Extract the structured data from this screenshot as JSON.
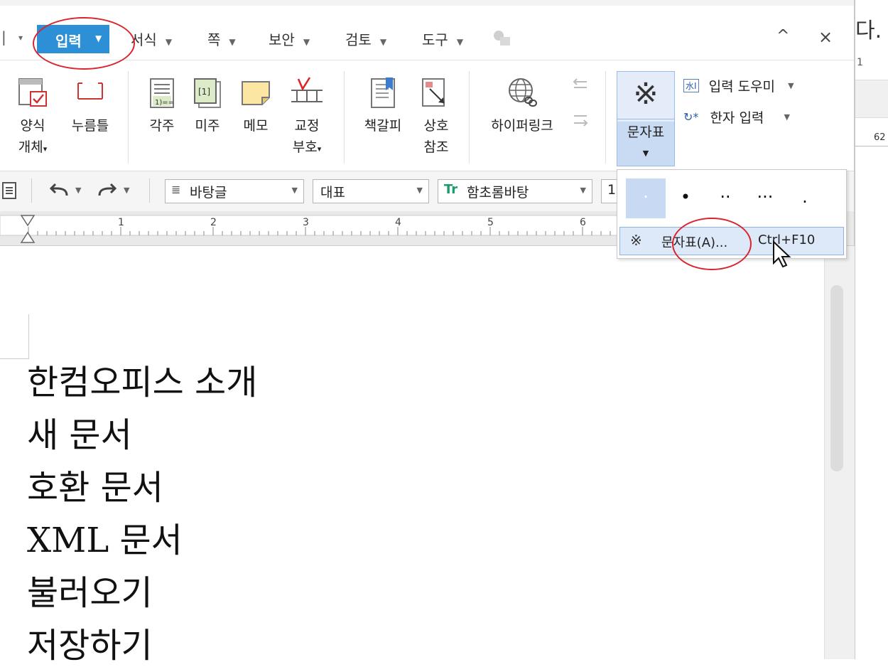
{
  "right_panel": {
    "top_char": "다.",
    "number_one": "1",
    "number": "62"
  },
  "menu": {
    "first_arrow": "▾",
    "items": [
      {
        "label": "입력",
        "active": true
      },
      {
        "label": "서식"
      },
      {
        "label": "쪽"
      },
      {
        "label": "보안"
      },
      {
        "label": "검토"
      },
      {
        "label": "도구"
      }
    ],
    "collapse": "^",
    "close": "×"
  },
  "ribbon": {
    "form_object": [
      "양식",
      "개체"
    ],
    "press_button": "누름틀",
    "footnote": "각주",
    "endnote": "미주",
    "memo": "메모",
    "proofread": [
      "교정",
      "부호"
    ],
    "bookmark": "책갈피",
    "cross_ref": [
      "상호",
      "참조"
    ],
    "hyperlink": "하이퍼링크",
    "char_map": "문자표",
    "input_helper": "입력 도우미",
    "hanja_input": "한자 입력"
  },
  "toolbar": {
    "style": "바탕글",
    "lang": "대표",
    "font": "함초롬바탕",
    "size": "1"
  },
  "ruler": {
    "marks": [
      "1",
      "2",
      "3",
      "4",
      "5",
      "6"
    ]
  },
  "dropdown": {
    "dots": [
      "·",
      "•",
      "··",
      "···",
      "."
    ],
    "item_symbol": "※",
    "item_label": "문자표(A)...",
    "item_shortcut": "Ctrl+F10"
  },
  "document": {
    "lines": [
      "한컴오피스 소개",
      "새 문서",
      "호환 문서",
      "XML 문서",
      "불러오기",
      "저장하기"
    ]
  },
  "colors": {
    "accent": "#2d8fd6",
    "highlight": "#dde8f8",
    "annotation": "#d9232d"
  }
}
